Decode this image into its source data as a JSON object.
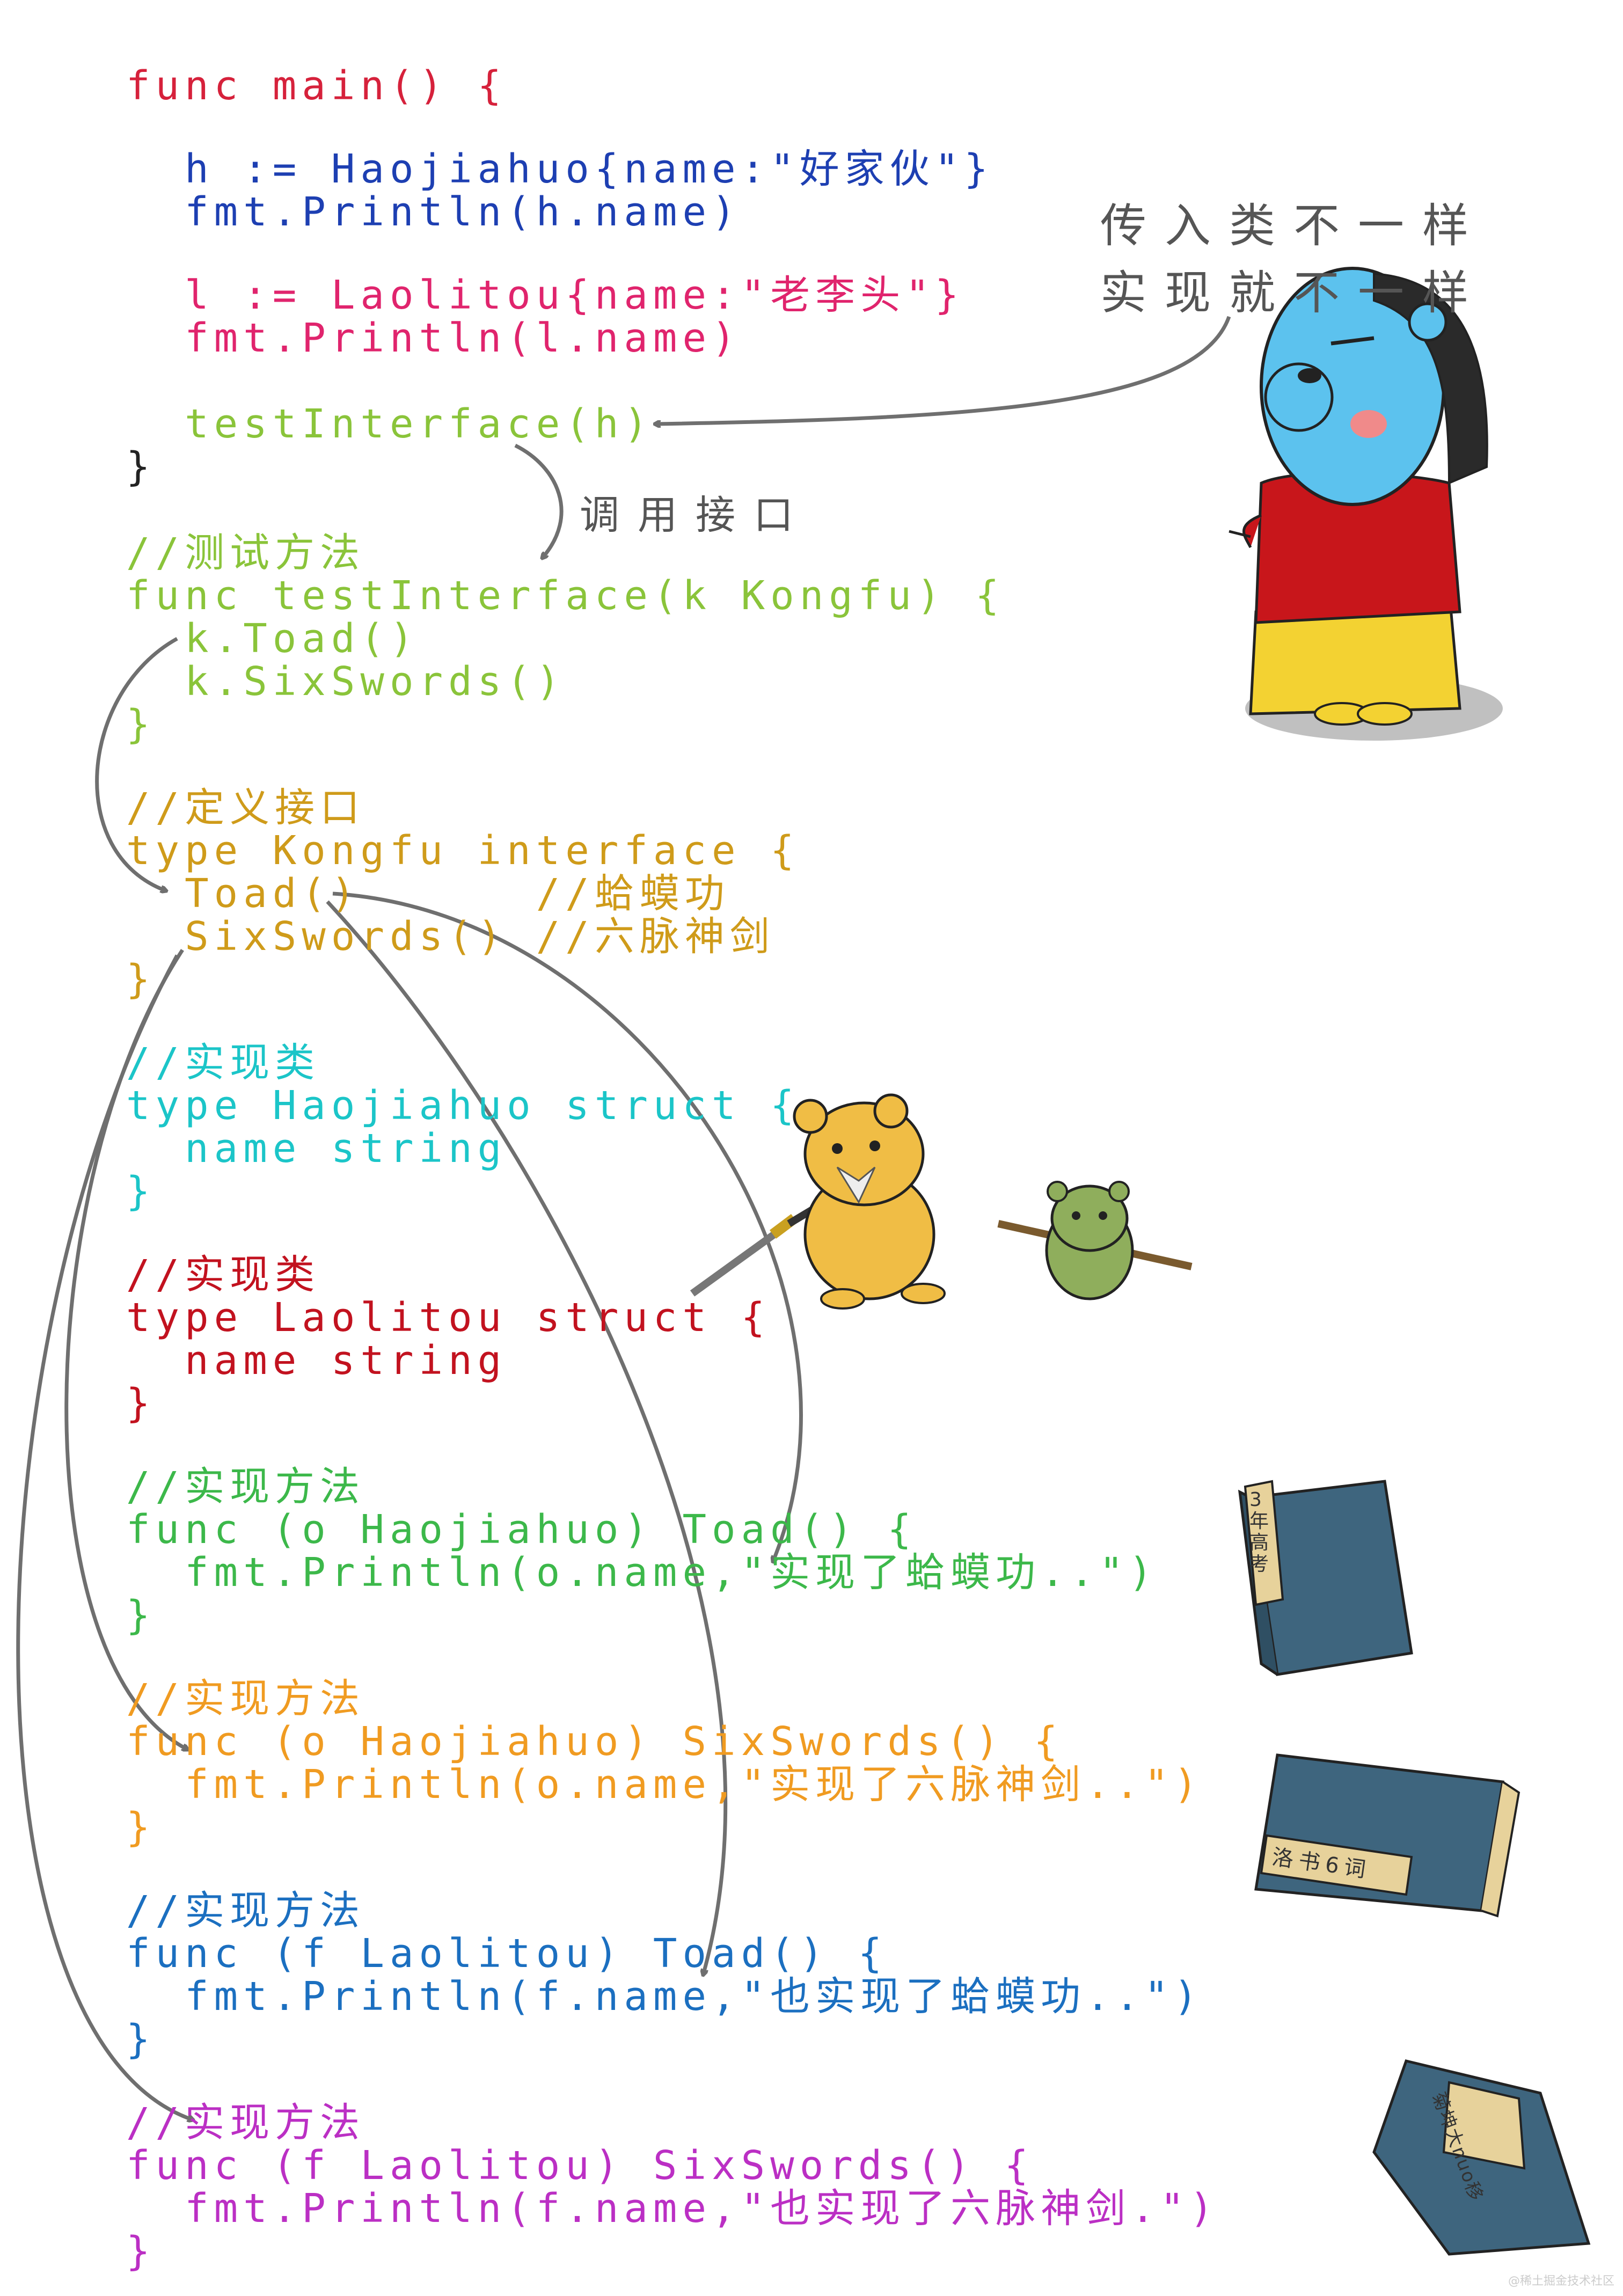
{
  "colors": {
    "main": "#d6213b",
    "hao": "#1d3fb2",
    "lao": "#e0246d",
    "call": "#8ac43a",
    "interface": "#cf9b1a",
    "struct_hao": "#1bc5c8",
    "struct_lao": "#c2121f",
    "impl1": "#3cb84a",
    "impl2": "#f09b21",
    "impl3": "#1b6fc0",
    "impl4": "#bb2fc4",
    "arrow": "#6f6f6f",
    "note": "#555555"
  },
  "code": {
    "main_open": "func main() {",
    "hao_decl": "  h := Haojiahuo{name:\"好家伙\"}",
    "hao_print": "  fmt.Println(h.name)",
    "lao_decl": "  l := Laolitou{name:\"老李头\"}",
    "lao_print": "  fmt.Println(l.name)",
    "call": "  testInterface(h)",
    "main_close": "}",
    "test_comment": "//测试方法",
    "test_sig": "func testInterface(k Kongfu) {",
    "test_toad": "  k.Toad()",
    "test_six": "  k.SixSwords()",
    "test_close": "}",
    "iface_comment": "//定义接口",
    "iface_sig": "type Kongfu interface {",
    "iface_toad": "  Toad()      //蛤蟆功",
    "iface_six": "  SixSwords() //六脉神剑",
    "iface_close": "}",
    "sh_comment": "//实现类",
    "sh_sig": "type Haojiahuo struct {",
    "sh_field": "  name string",
    "sh_close": "}",
    "sl_comment": "//实现类",
    "sl_sig": "type Laolitou struct {",
    "sl_field": "  name string",
    "sl_close": "}",
    "m1_comment": "//实现方法",
    "m1_sig": "func (o Haojiahuo) Toad() {",
    "m1_body": "  fmt.Println(o.name,\"实现了蛤蟆功..\")",
    "m1_close": "}",
    "m2_comment": "//实现方法",
    "m2_sig": "func (o Haojiahuo) SixSwords() {",
    "m2_body": "  fmt.Println(o.name,\"实现了六脉神剑..\")",
    "m2_close": "}",
    "m3_comment": "//实现方法",
    "m3_sig": "func (f Laolitou) Toad() {",
    "m3_body": "  fmt.Println(f.name,\"也实现了蛤蟆功..\")",
    "m3_close": "}",
    "m4_comment": "//实现方法",
    "m4_sig": "func (f Laolitou) SixSwords() {",
    "m4_body": "  fmt.Println(f.name,\"也实现了六脉神剑.\")",
    "m4_close": "}"
  },
  "notes": {
    "line1": "传入类不一样",
    "line2": "实现就不一样",
    "call_label": "调用接口"
  },
  "books": {
    "book1": "3年高考",
    "book2": "洛书6词",
    "book3": "菊坤大nuo移"
  },
  "watermark": "@稀土掘金技术社区"
}
